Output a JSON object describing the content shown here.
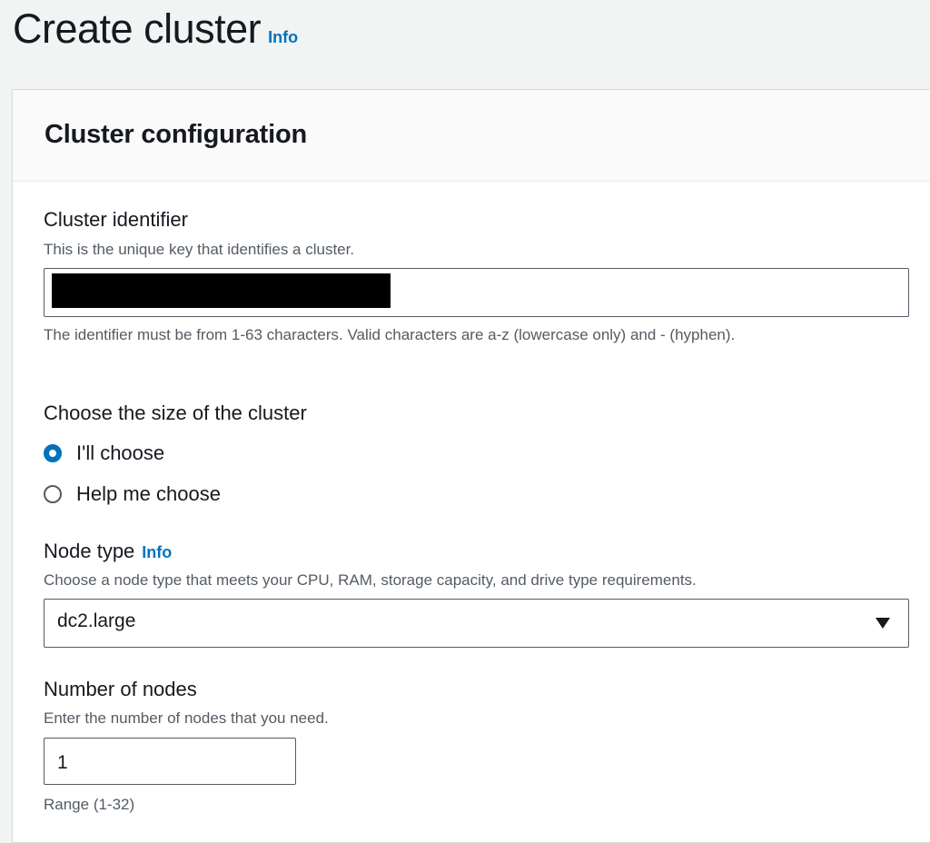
{
  "header": {
    "title": "Create cluster",
    "info": "Info"
  },
  "panel": {
    "title": "Cluster configuration"
  },
  "cluster_identifier": {
    "label": "Cluster identifier",
    "description": "This is the unique key that identifies a cluster.",
    "hint": "The identifier must be from 1-63 characters. Valid characters are a-z (lowercase only) and - (hyphen)."
  },
  "cluster_size": {
    "label": "Choose the size of the cluster",
    "options": [
      {
        "label": "I'll choose",
        "selected": true
      },
      {
        "label": "Help me choose",
        "selected": false
      }
    ]
  },
  "node_type": {
    "label": "Node type",
    "info": "Info",
    "description": "Choose a node type that meets your CPU, RAM, storage capacity, and drive type requirements.",
    "value": "dc2.large"
  },
  "number_of_nodes": {
    "label": "Number of nodes",
    "description": "Enter the number of nodes that you need.",
    "value": "1",
    "hint": "Range (1-32)"
  },
  "colors": {
    "accent": "#0073bb",
    "text": "#16191f",
    "secondary": "#545b64"
  }
}
